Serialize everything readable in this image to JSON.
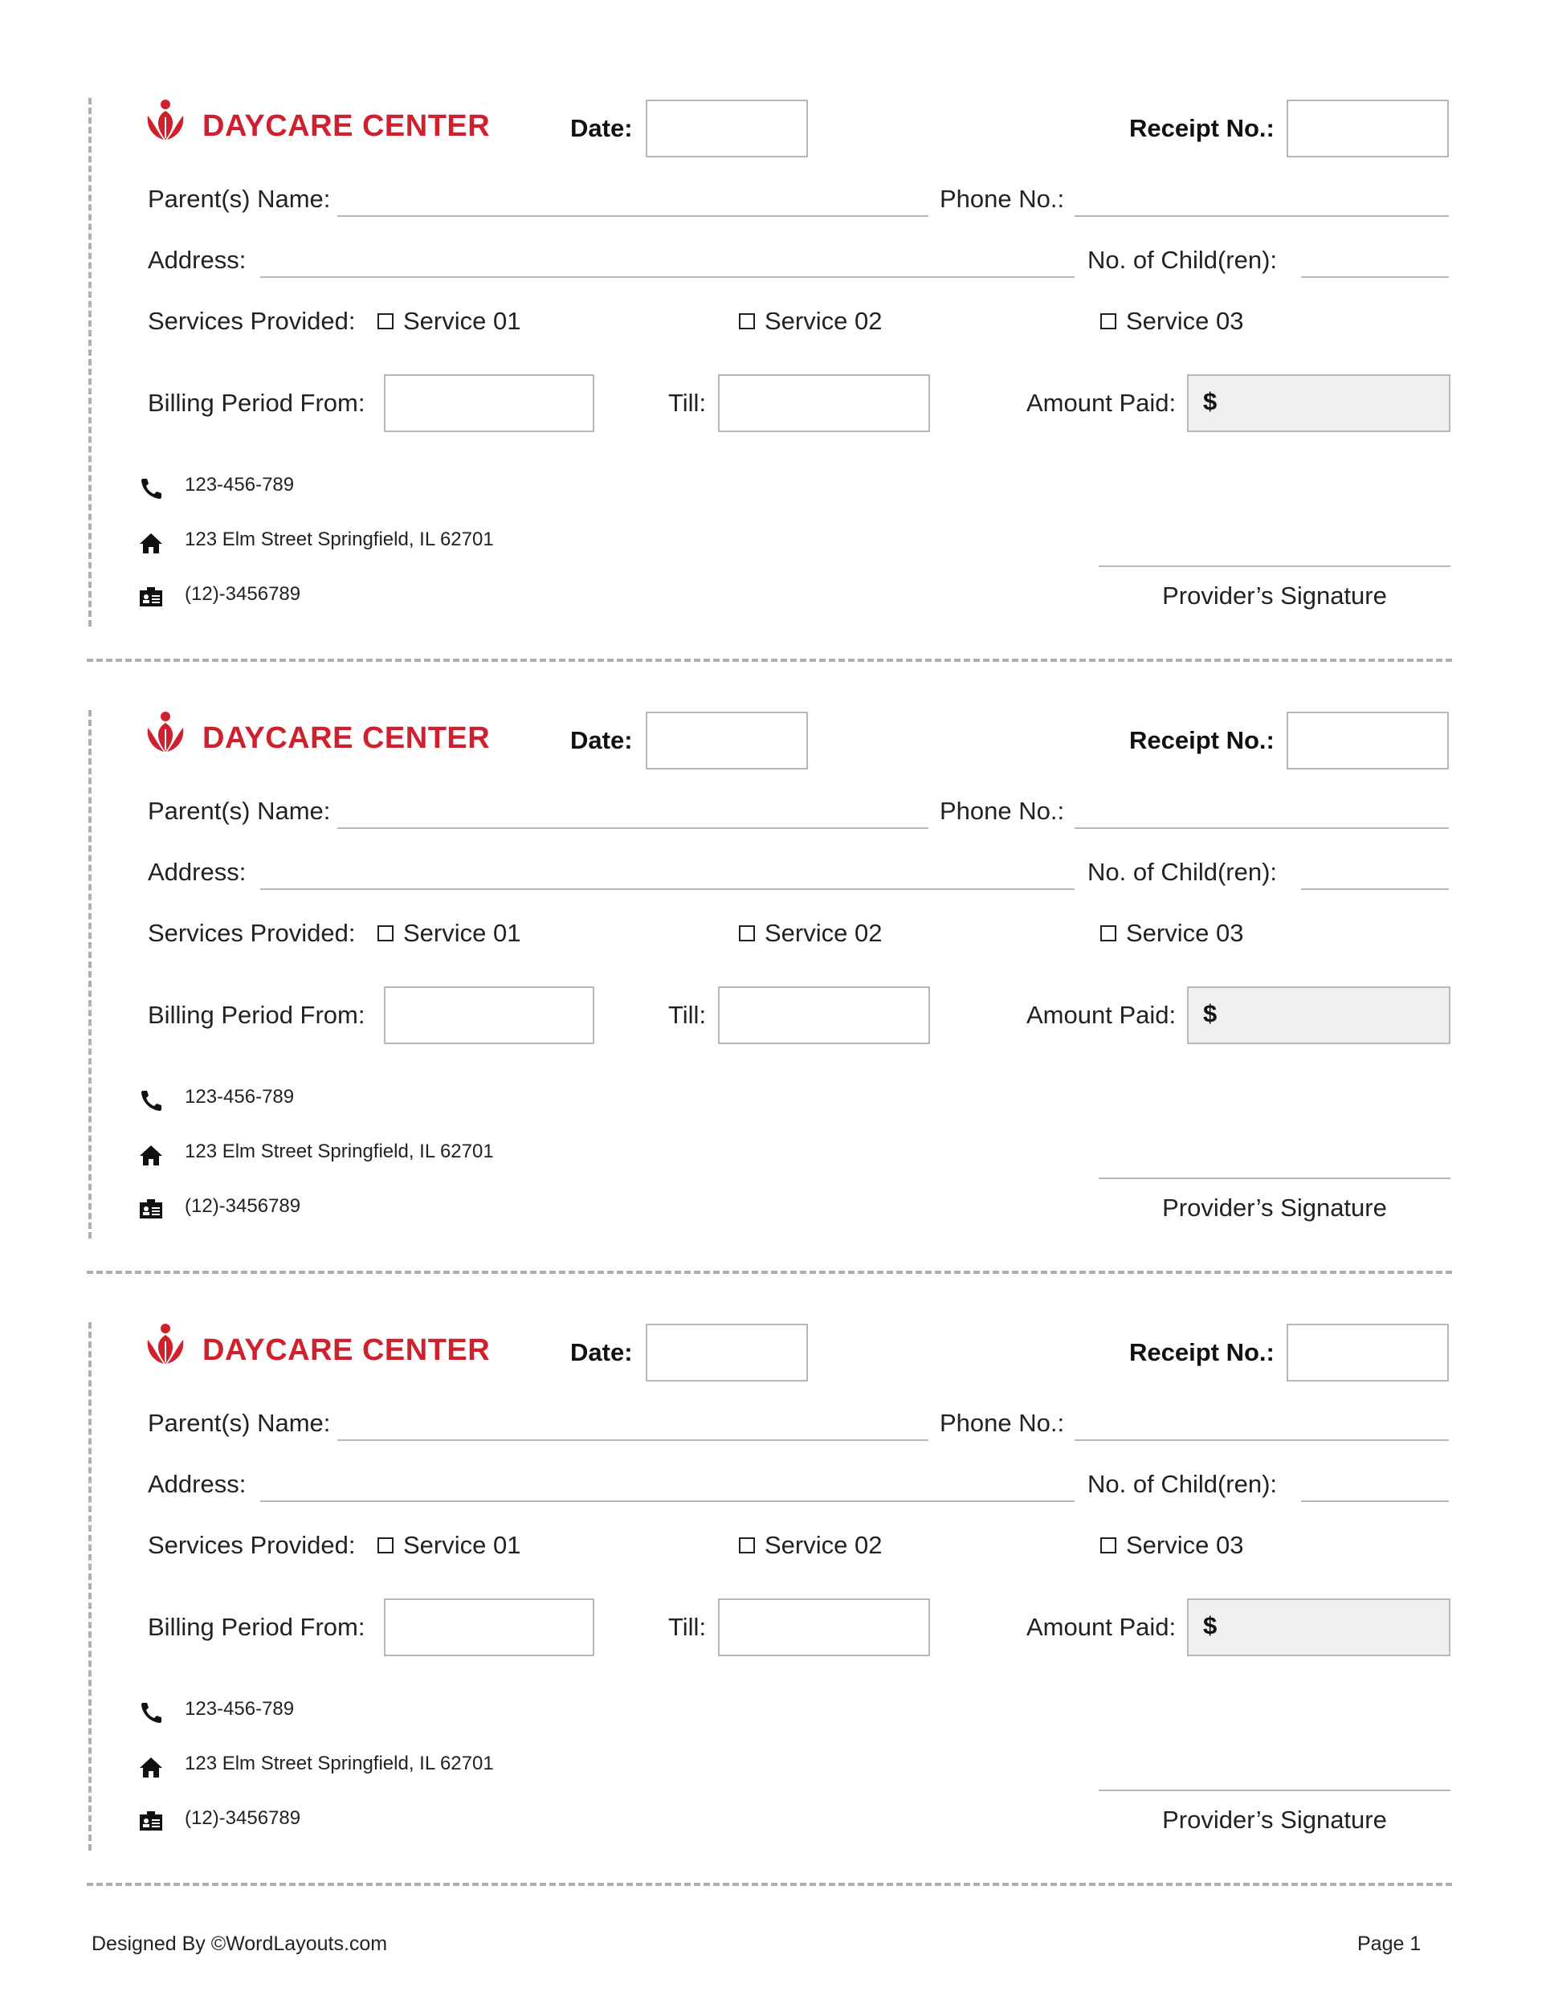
{
  "brand": {
    "name": "DAYCARE CENTER",
    "color": "#d0202e",
    "logo_icon": "flower-people-logo"
  },
  "labels": {
    "date": "Date:",
    "receipt_no": "Receipt No.:",
    "parents_name": "Parent(s) Name:",
    "phone_no": "Phone No.:",
    "address": "Address:",
    "no_children": "No. of Child(ren):",
    "services_provided": "Services Provided:",
    "service_1": "Service 01",
    "service_2": "Service 02",
    "service_3": "Service 03",
    "billing_from": "Billing Period From:",
    "till": "Till:",
    "amount_paid": "Amount Paid:",
    "currency": "$",
    "signature": "Provider’s Signature"
  },
  "contact": {
    "phone": "123-456-789",
    "address": "123 Elm Street Springfield, IL 62701",
    "fax": "(12)-3456789",
    "icons": [
      "phone-icon",
      "home-icon",
      "contact-card-icon"
    ]
  },
  "receipts": [
    {
      "date": "",
      "receipt_no": "",
      "parents_name": "",
      "phone_no": "",
      "address": "",
      "no_children": "",
      "billing_from": "",
      "till": "",
      "amount": ""
    },
    {
      "date": "",
      "receipt_no": "",
      "parents_name": "",
      "phone_no": "",
      "address": "",
      "no_children": "",
      "billing_from": "",
      "till": "",
      "amount": ""
    },
    {
      "date": "",
      "receipt_no": "",
      "parents_name": "",
      "phone_no": "",
      "address": "",
      "no_children": "",
      "billing_from": "",
      "till": "",
      "amount": ""
    }
  ],
  "footer": {
    "credit": "Designed By ©WordLayouts.com",
    "page": "Page 1"
  }
}
